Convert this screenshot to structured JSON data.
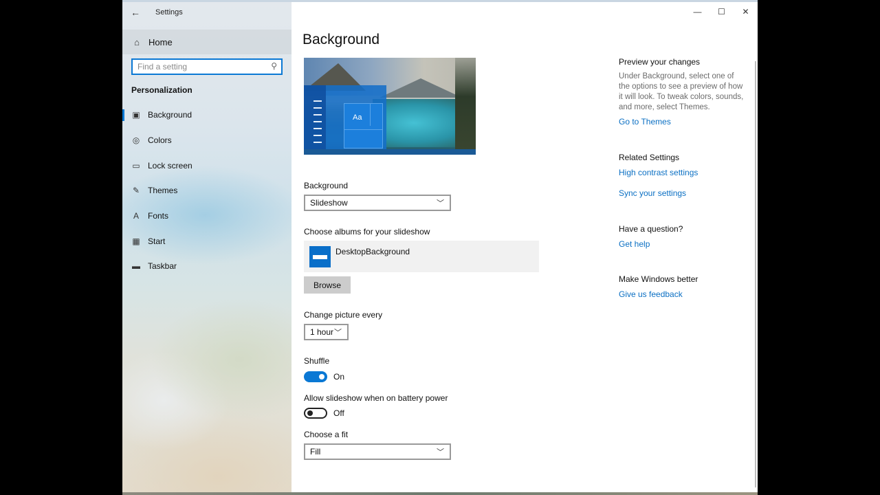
{
  "app": {
    "title": "Settings"
  },
  "titlebar": {
    "back_glyph": "←",
    "minimize_glyph": "—",
    "maximize_glyph": "☐",
    "close_glyph": "✕"
  },
  "sidebar": {
    "home_label": "Home",
    "search_placeholder": "Find a setting",
    "section_title": "Personalization",
    "items": [
      {
        "label": "Background",
        "icon": "picture-icon",
        "glyph": "▣",
        "active": true
      },
      {
        "label": "Colors",
        "icon": "palette-icon",
        "glyph": "◎",
        "active": false
      },
      {
        "label": "Lock screen",
        "icon": "lock-screen-icon",
        "glyph": "▭",
        "active": false
      },
      {
        "label": "Themes",
        "icon": "brush-icon",
        "glyph": "✎",
        "active": false
      },
      {
        "label": "Fonts",
        "icon": "font-icon",
        "glyph": "A",
        "active": false
      },
      {
        "label": "Start",
        "icon": "start-grid-icon",
        "glyph": "▦",
        "active": false
      },
      {
        "label": "Taskbar",
        "icon": "taskbar-icon",
        "glyph": "▬",
        "active": false
      }
    ]
  },
  "main": {
    "title": "Background",
    "preview_tile_text": "Aa",
    "background_label": "Background",
    "background_value": "Slideshow",
    "albums_label": "Choose albums for your slideshow",
    "album_name": "DesktopBackground",
    "browse_label": "Browse",
    "change_label": "Change picture every",
    "change_value": "1 hour",
    "shuffle_label": "Shuffle",
    "shuffle_state": "On",
    "battery_label": "Allow slideshow when on battery power",
    "battery_state": "Off",
    "fit_label": "Choose a fit",
    "fit_value": "Fill"
  },
  "right_panel": {
    "preview_heading": "Preview your changes",
    "preview_text": "Under Background, select one of the options to see a preview of how it will look. To tweak colors, sounds, and more, select Themes.",
    "themes_link": "Go to Themes",
    "related_heading": "Related Settings",
    "high_contrast_link": "High contrast settings",
    "sync_link": "Sync your settings",
    "question_heading": "Have a question?",
    "help_link": "Get help",
    "better_heading": "Make Windows better",
    "feedback_link": "Give us feedback"
  },
  "colors": {
    "accent": "#0a78d4",
    "link": "#0a6fc3"
  }
}
